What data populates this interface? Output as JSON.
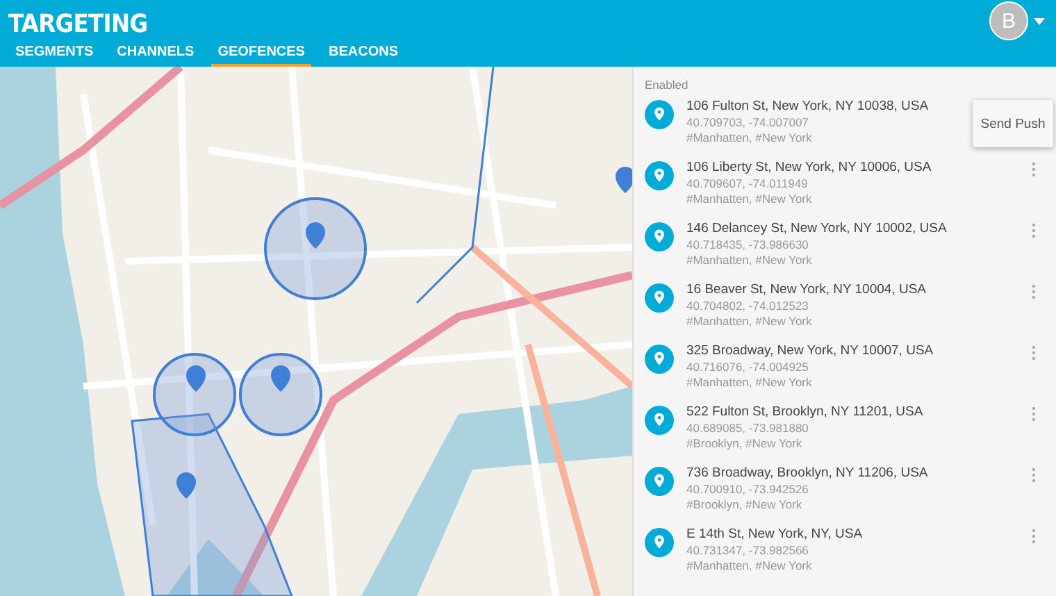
{
  "app_bar": {
    "title": "TARGETING",
    "avatar": "B"
  },
  "tabs": [
    {
      "label": "SEGMENTS",
      "selected": false
    },
    {
      "label": "CHANNELS",
      "selected": false
    },
    {
      "label": "GEOFENCES",
      "selected": true
    },
    {
      "label": "BEACONS",
      "selected": false
    }
  ],
  "panel": {
    "section_label": "Enabled",
    "menu_item": "Send Push",
    "locations": [
      {
        "address": "106 Fulton St, New York, NY 10038, USA",
        "coordinates": "40.709703, -74.007007",
        "tags": "#Manhatten, #New York",
        "menu_open": true
      },
      {
        "address": "106 Liberty St, New York, NY 10006, USA",
        "coordinates": "40.709607, -74.011949",
        "tags": "#Manhatten, #New York",
        "menu_open": false
      },
      {
        "address": "146 Delancey St, New York, NY 10002, USA",
        "coordinates": "40.718435, -73.986630",
        "tags": "#Manhatten, #New York",
        "menu_open": false
      },
      {
        "address": "16 Beaver St, New York, NY 10004, USA",
        "coordinates": "40.704802, -74.012523",
        "tags": "#Manhatten, #New York",
        "menu_open": false
      },
      {
        "address": "325 Broadway, New York, NY 10007, USA",
        "coordinates": "40.716076, -74.004925",
        "tags": "#Manhatten, #New York",
        "menu_open": false
      },
      {
        "address": "522 Fulton St, Brooklyn, NY 11201, USA",
        "coordinates": "40.689085, -73.981880",
        "tags": "#Brooklyn, #New York",
        "menu_open": false
      },
      {
        "address": "736 Broadway, Brooklyn, NY 11206, USA",
        "coordinates": "40.700910, -73.942526",
        "tags": "#Brooklyn, #New York",
        "menu_open": false
      },
      {
        "address": "E 14th St, New York, NY, USA",
        "coordinates": "40.731347, -73.982566",
        "tags": "#Manhatten, #New York",
        "menu_open": false
      }
    ]
  }
}
